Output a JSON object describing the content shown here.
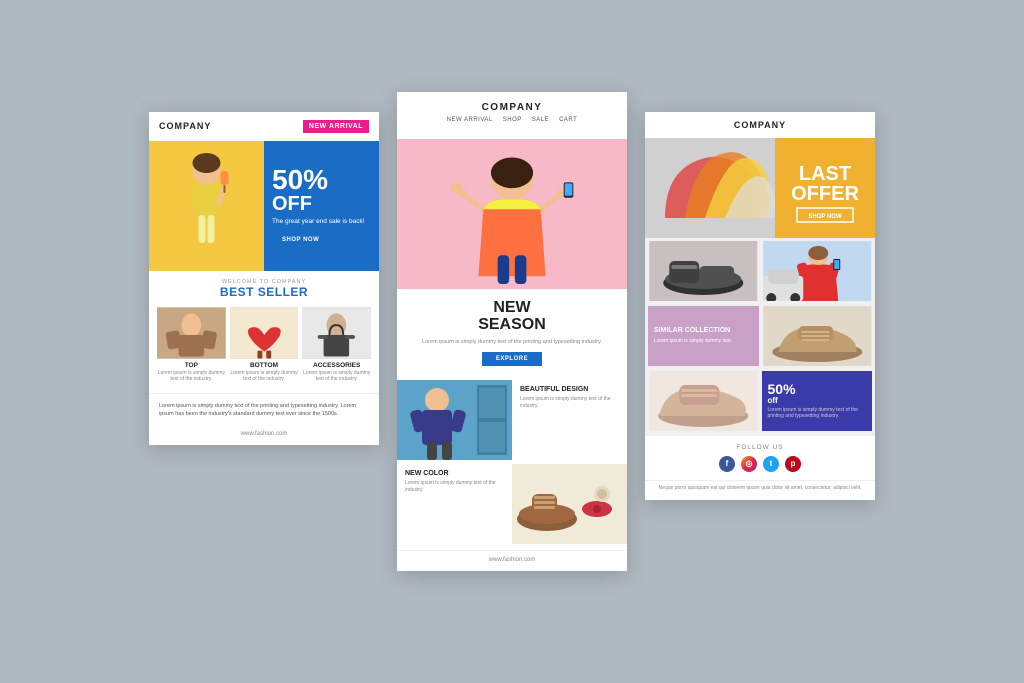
{
  "background": "#b0b8c1",
  "card1": {
    "company": "COMPANY",
    "new_arrival_badge": "NEW ARRIVAL",
    "hero": {
      "discount": "50%",
      "off": "OFF",
      "tagline": "The great year end sale is back!",
      "shop_now": "SHOP NOW"
    },
    "welcome": "WELCOME TO COMPANY",
    "best_seller": "BEST SELLER",
    "products": [
      {
        "label": "TOP",
        "desc": "Lorem ipsum is simply dummy text of the industry."
      },
      {
        "label": "BOTTOM",
        "desc": "Lorem ipsum is simply dummy text of the industry."
      },
      {
        "label": "ACCESSORIES",
        "desc": "Lorem ipsum is simply dummy text of the industry."
      }
    ],
    "footer_text": "Lorem ipsum is simply dummy text of the printing and typesetting industry. Lorem ipsum has been the industry's standard dummy text ever since the 1500s.",
    "footer_url": "www.fashion.com"
  },
  "card2": {
    "company": "COMPANY",
    "nav": [
      "NEW ARRIVAL",
      "SHOP",
      "SALE",
      "CART"
    ],
    "hero_new_season": "NEW\nSEASON",
    "new_season_desc": "Lorem ipsum is simply dummy text of the printing and typesetting industry.",
    "explore_btn": "EXPLORE",
    "feature1": {
      "title": "BEAUTIFUL DESIGN",
      "desc": "Lorem ipsum is simply dummy text of the industry."
    },
    "feature2": {
      "title": "NEW COLOR",
      "desc": "Lorem ipsum is simply dummy text of the industry."
    },
    "footer_url": "www.fashion.com"
  },
  "card3": {
    "company": "COMPANY",
    "hero": {
      "last_offer": "LAST OFFER",
      "shop_now": "SHOP NOW"
    },
    "similar_collection": {
      "title": "SIMILAR COLLECTION",
      "desc": "Lorem ipsum is simply dummy text."
    },
    "discount": {
      "percent": "50%",
      "off": "off",
      "desc": "Lorem ipsum is simply dummy text of the printing and typesetting industry."
    },
    "follow_us": "FOLLOW US",
    "social_icons": [
      "facebook",
      "instagram",
      "twitter",
      "pinterest"
    ],
    "footer_text": "Neque porro quisquam est qui dolorem ipsum quia dolor sit amet, consectetur, adipisci velit."
  }
}
